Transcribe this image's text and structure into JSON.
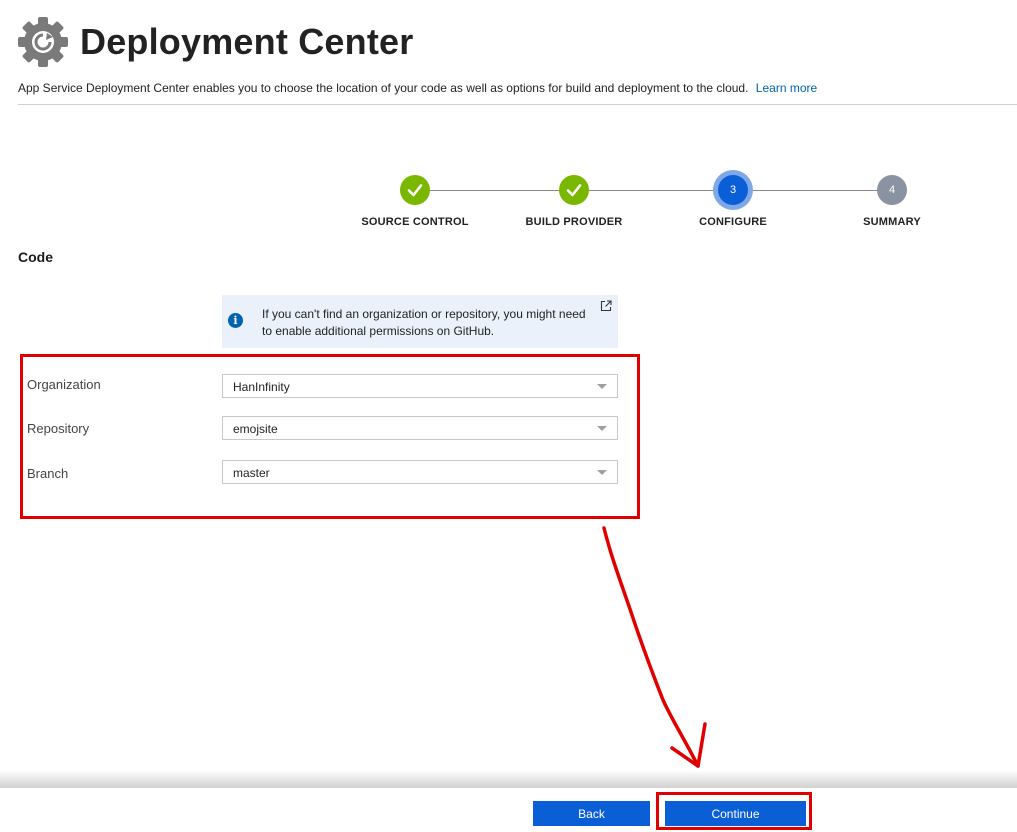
{
  "header": {
    "title": "Deployment Center",
    "subtitle": "App Service Deployment Center enables you to choose the location of your code as well as options for build and deployment to the cloud.",
    "learn_more": "Learn more"
  },
  "stepper": {
    "steps": [
      {
        "label": "SOURCE CONTROL",
        "state": "done",
        "number": "1"
      },
      {
        "label": "BUILD PROVIDER",
        "state": "done",
        "number": "2"
      },
      {
        "label": "CONFIGURE",
        "state": "current",
        "number": "3"
      },
      {
        "label": "SUMMARY",
        "state": "todo",
        "number": "4"
      }
    ]
  },
  "section": {
    "title": "Code"
  },
  "info": {
    "text": "If you can't find an organization or repository, you might need to enable additional permissions on GitHub.",
    "icon": "info-icon",
    "link_icon": "external-link-icon"
  },
  "fields": {
    "organization": {
      "label": "Organization",
      "value": "HanInfinity"
    },
    "repository": {
      "label": "Repository",
      "value": "emojsite"
    },
    "branch": {
      "label": "Branch",
      "value": "master"
    }
  },
  "footer": {
    "back_label": "Back",
    "continue_label": "Continue"
  },
  "colors": {
    "accent": "#0a5fd7",
    "done": "#7ab800",
    "annotation": "#e00000"
  }
}
